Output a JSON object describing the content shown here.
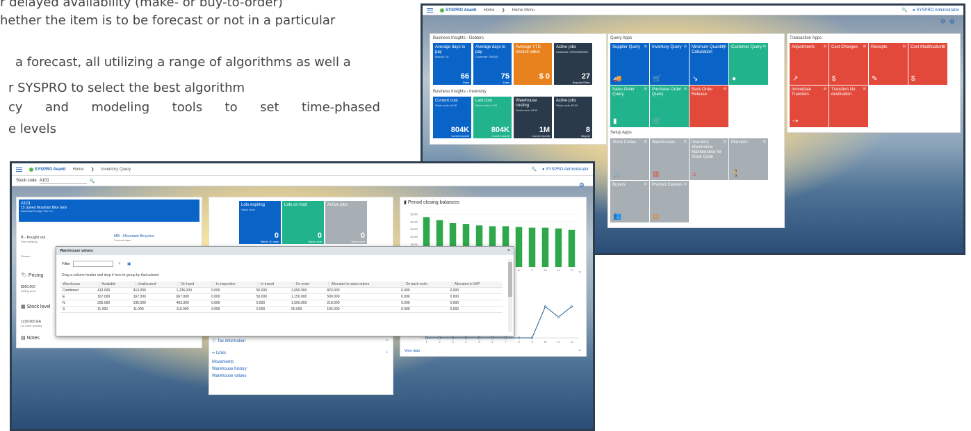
{
  "bg_text": {
    "line1": "r delayed availability (make- or buy-to-order)",
    "line2": "hether the item is to be forecast or not in a particular",
    "line3": "a forecast, all utilizing a range of algorithms as well a",
    "line4": "r SYSPRO to select the best algorithm",
    "line5a": "cy",
    "line5b": "and",
    "line5c": "modeling",
    "line5d": "tools",
    "line5e": "to",
    "line5f": "set",
    "line5g": "time-phased",
    "line6": "e levels"
  },
  "home": {
    "logo": "SYSPRO Avanti",
    "home": "Home",
    "menu": "Home Menu",
    "user": "SYSPRO Administrator",
    "debtors_title": "Business Insights - Debtors",
    "debtors": [
      {
        "t": "Average days to pay",
        "s": "Branch: 10",
        "n": "66",
        "u": "Days",
        "c": "blue"
      },
      {
        "t": "Average days to pay",
        "s": "Customer: 000001",
        "n": "75",
        "u": "Days",
        "c": "blue"
      },
      {
        "t": "Average YTD invoice value",
        "s": "",
        "n": "$ 0",
        "u": "",
        "c": "orange"
      },
      {
        "t": "Active jobs",
        "s": "Customer: 000000000001",
        "n": "27",
        "u": "Bayside Bikes",
        "c": "dark"
      }
    ],
    "inventory_title": "Business Insights - Inventory",
    "inventory": [
      {
        "t": "Current cost",
        "s": "Stock code: A100",
        "n": "804K",
        "u": "Current month",
        "c": "blue"
      },
      {
        "t": "Last cost",
        "s": "Stock code: A100",
        "n": "804K",
        "u": "Current month",
        "c": "green"
      },
      {
        "t": "Warehouse costing",
        "s": "Stock code: A100",
        "n": "1M",
        "u": "Current month",
        "c": "dark"
      },
      {
        "t": "Active jobs",
        "s": "Stock code: B100",
        "n": "8",
        "u": "Bicycle",
        "c": "dark"
      }
    ],
    "query_title": "Query Apps",
    "query": [
      {
        "t": "Supplier Query",
        "c": "blue",
        "i": "🚚"
      },
      {
        "t": "Inventory Query",
        "c": "blue",
        "i": "🛒"
      },
      {
        "t": "Minimum Quantity Calculation",
        "c": "blue",
        "i": "↘"
      },
      {
        "t": "Customer Query",
        "c": "green",
        "i": "●"
      },
      {
        "t": "Sales Order Query",
        "c": "green",
        "i": "▮"
      },
      {
        "t": "Purchase Order Query",
        "c": "green",
        "i": "🛒"
      },
      {
        "t": "Back Order Release",
        "c": "red",
        "i": ""
      }
    ],
    "trans_title": "Transaction Apps",
    "trans": [
      {
        "t": "Adjustments",
        "i": "↗"
      },
      {
        "t": "Cost Changes",
        "i": "$"
      },
      {
        "t": "Receipts",
        "i": "✎"
      },
      {
        "t": "Cost Modifications",
        "i": "$"
      },
      {
        "t": "Immediate Transfers",
        "i": "⇢"
      },
      {
        "t": "Transfers No destination",
        "i": ""
      }
    ],
    "setup_title": "Setup Apps",
    "setup": [
      {
        "t": "Stock Codes",
        "i": "🛒",
        "ic": "#e3493b"
      },
      {
        "t": "Warehouses",
        "i": "▥",
        "ic": "#e3493b"
      },
      {
        "t": "Inventory Warehouse Maintenance for Stock Code",
        "i": "⌂",
        "ic": "#e3493b"
      },
      {
        "t": "Planners",
        "i": "🚶",
        "ic": "#e8821e"
      },
      {
        "t": "Buyers",
        "i": "👥",
        "ic": "#e8821e"
      },
      {
        "t": "Product Classes",
        "i": "▤",
        "ic": "#e8821e"
      }
    ]
  },
  "inv": {
    "logo": "SYSPRO Avanti",
    "home": "Home",
    "crumb": "Inventory Query",
    "user": "SYSPRO Administrator",
    "stock_label": "Stock code",
    "stock_value": "A101",
    "item_code": "A101",
    "item_desc": "15 Speed Mountain Bike Girls",
    "item_sub": "Distribution/Foreign Price Cur",
    "part_cat": "B - Bought out",
    "part_cat_lbl": "Part category",
    "prod_class": "MB - Mountain Bicycles",
    "prod_class_lbl": "Product class",
    "planner": "Planner",
    "pricing": "Pricing",
    "price": "$560.000",
    "price_lbl": "Selling price",
    "stock_level": "Stock level",
    "onhand": "1236.000 EA",
    "onhand_lbl": "On hand quantity",
    "notes": "Notes",
    "tiles": [
      {
        "t": "Lots expiring",
        "s": "Stock code",
        "n": "0",
        "u": "Within 30 days",
        "c": "blue"
      },
      {
        "t": "Lots on hold",
        "s": "",
        "n": "0",
        "u": "Stock code",
        "c": "green"
      },
      {
        "t": "Active jobs",
        "s": "",
        "n": "0",
        "u": "Stock code",
        "c": "gray"
      }
    ],
    "tax": "Tax information",
    "links": "Links",
    "link_items": [
      "Movements",
      "Warehouse history",
      "Warehouse values"
    ],
    "chart_title": "Period closing balances",
    "view_data": "View data"
  },
  "dialog": {
    "title": "Warehouse values",
    "filter": "Filter",
    "group_hint": "Drag a column header and drop it here to group by that column",
    "columns": [
      "Warehouse",
      "Available",
      "Unallocated",
      "On hand",
      "In inspection",
      "In transit",
      "On order",
      "Allocated to sales orders",
      "On back order",
      "Allocated to WIP"
    ],
    "rows": [
      [
        "Combined",
        "413.000",
        "413.000",
        "1,236.000",
        "0.000",
        "50.000",
        "2,650.000",
        "823.000",
        "0.000",
        "0.000"
      ],
      [
        "E",
        "167.000",
        "167.000",
        "667.000",
        "0.000",
        "50.000",
        "1,150.000",
        "500.000",
        "0.000",
        "0.000"
      ],
      [
        "N",
        "235.000",
        "235.000",
        "463.000",
        "0.000",
        "0.000",
        "1,500.000",
        "218.000",
        "0.000",
        "0.000"
      ],
      [
        "S",
        "11.000",
        "11.000",
        "116.000",
        "0.000",
        "0.000",
        "50.000",
        "105.000",
        "0.000",
        "0.000"
      ]
    ]
  },
  "chart_data": [
    {
      "type": "bar",
      "title": "Period closing balances",
      "categories": [
        "1",
        "2",
        "3",
        "4",
        "5",
        "6",
        "7",
        "8",
        "9",
        "10",
        "11",
        "12"
      ],
      "values": [
        33000,
        31000,
        29000,
        28500,
        27500,
        27000,
        27000,
        26500,
        26000,
        26000,
        25500,
        24500
      ],
      "ylim": [
        0,
        35000
      ],
      "yticks": [
        "35,000",
        "30,000",
        "25,000",
        "20,000",
        "15,000",
        "10,000",
        "5,000",
        "0"
      ]
    },
    {
      "type": "line",
      "categories": [
        "1",
        "2",
        "3",
        "4",
        "5",
        "6",
        "7",
        "8",
        "9",
        "10",
        "11",
        "12"
      ],
      "values": [
        0,
        0,
        0,
        0,
        0,
        0,
        0,
        0,
        0,
        3,
        2,
        3
      ]
    }
  ],
  "colors": {
    "blue": "#0a64c8",
    "green": "#20b38c",
    "orange": "#e8821e",
    "dark": "#2b3a4a",
    "red": "#e3493b",
    "gray": "#a7aeb4"
  }
}
